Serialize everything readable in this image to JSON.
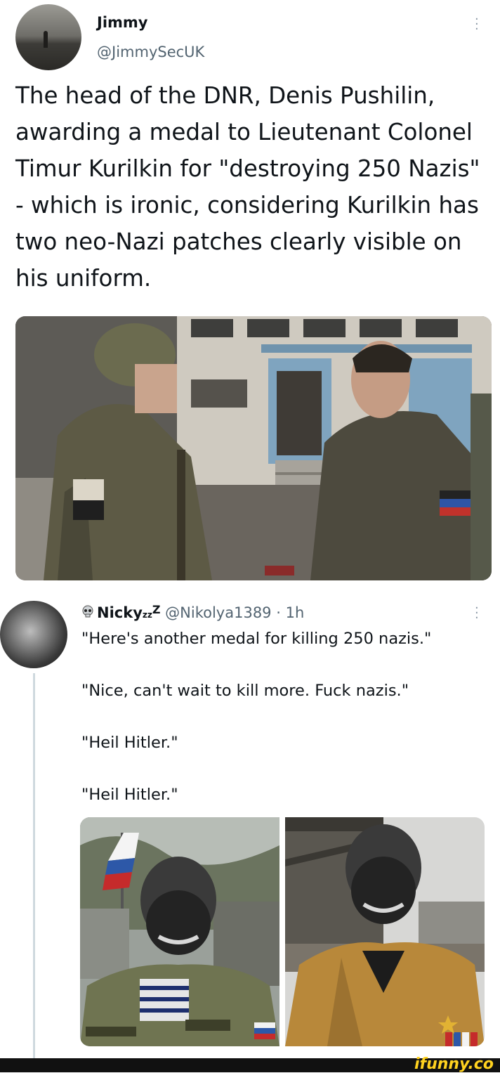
{
  "tweet": {
    "author_name": "Jimmy",
    "author_handle": "@JimmySecUK",
    "text": "The head of the DNR, Denis Pushilin, awarding a medal to Lieutenant Colonel Timur Kurilkin for \"destroying 250 Nazis\" - which is ironic, considering Kurilkin has two neo-Nazi patches clearly visible on his uniform.",
    "more_icon": "more-vertical-icon"
  },
  "reply": {
    "emoji": "skull-icon",
    "name": "Nicky",
    "name_suffix_small": "zz",
    "name_suffix_big": "Z",
    "handle": "@Nikolya1389",
    "separator": "·",
    "time": "1h",
    "lines": [
      "\"Here's another medal for killing 250 nazis.\"",
      "\"Nice, can't wait to kill more. Fuck nazis.\"",
      "\"Heil Hitler.\"",
      "\"Heil Hitler.\""
    ]
  },
  "watermark": "ifunny.co",
  "colors": {
    "text": "#0f1419",
    "secondary": "#536471",
    "thread_line": "#cfd9de",
    "watermark": "#ffd21f"
  }
}
